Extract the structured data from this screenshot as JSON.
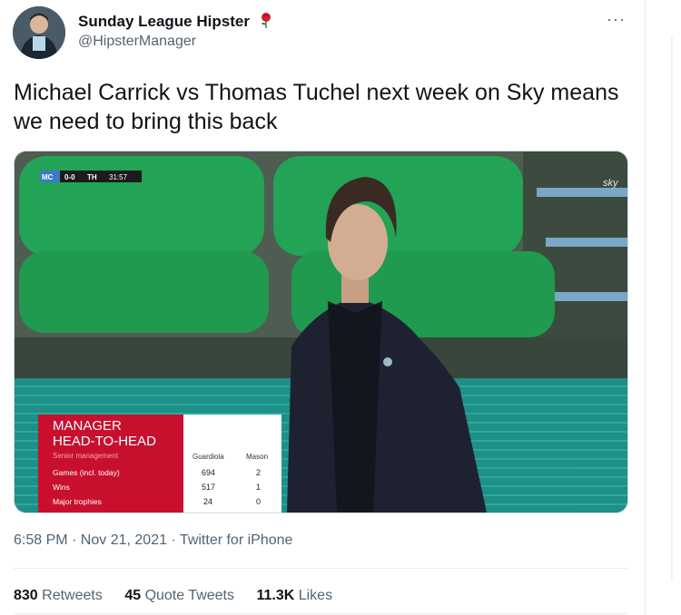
{
  "author": {
    "display_name": "Sunday League Hipster",
    "handle": "@HipsterManager",
    "badge_icon": "rose-icon"
  },
  "tweet": {
    "text": "Michael Carrick vs Thomas Tuchel next week on Sky means we need to bring this back",
    "timestamp": "6:58 PM · Nov 21, 2021",
    "source": "Twitter for iPhone"
  },
  "media": {
    "scorebug": {
      "home": "MC",
      "score": "0-0",
      "away": "TH",
      "clock": "31:57"
    },
    "broadcaster": "sky",
    "graphic": {
      "title_line1": "MANAGER",
      "title_line2": "HEAD-TO-HEAD",
      "subtitle": "Senior management",
      "columns": [
        "Guardiola",
        "Mason"
      ],
      "rows": [
        {
          "label": "Games (incl. today)",
          "values": [
            "694",
            "2"
          ]
        },
        {
          "label": "Wins",
          "values": [
            "517",
            "1"
          ]
        },
        {
          "label": "Major trophies",
          "values": [
            "24",
            "0"
          ]
        }
      ]
    }
  },
  "stats": {
    "retweets_count": "830",
    "retweets_label": "Retweets",
    "quotes_count": "45",
    "quotes_label": "Quote Tweets",
    "likes_count": "11.3K",
    "likes_label": "Likes"
  },
  "colors": {
    "text_primary": "#0f1419",
    "text_secondary": "#536471",
    "graphic_red": "#c8102e",
    "seat_green": "#1f9a4e"
  }
}
